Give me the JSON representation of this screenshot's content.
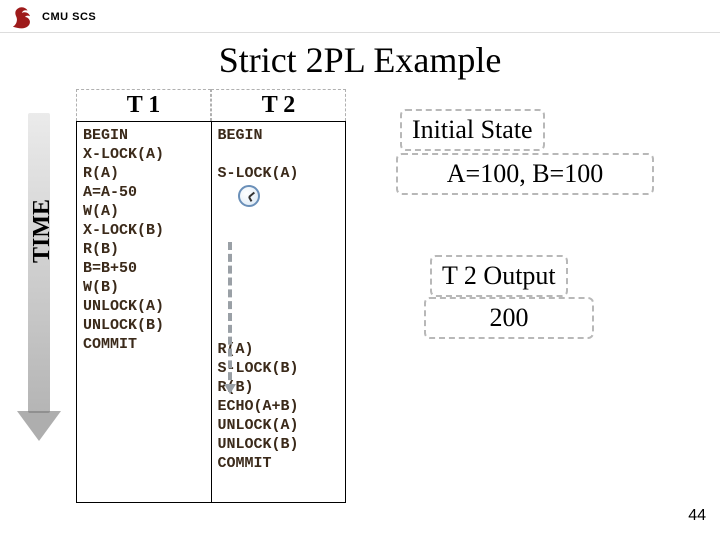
{
  "header": {
    "school": "CMU SCS"
  },
  "title": "Strict 2PL Example",
  "time_label": "TIME",
  "schedule": {
    "t1": {
      "header": "T 1",
      "ops": [
        "BEGIN",
        "X-LOCK(A)",
        "R(A)",
        "A=A-50",
        "W(A)",
        "X-LOCK(B)",
        "R(B)",
        "B=B+50",
        "W(B)",
        "UNLOCK(A)",
        "UNLOCK(B)",
        "COMMIT"
      ]
    },
    "t2": {
      "header": "T 2",
      "begin": "BEGIN",
      "first_lock": "S-LOCK(A)",
      "resume": [
        "R(A)",
        "S-LOCK(B)",
        "R(B)",
        "ECHO(A+B)",
        "UNLOCK(A)",
        "UNLOCK(B)",
        "COMMIT"
      ]
    }
  },
  "panels": {
    "initial_label": "Initial State",
    "initial_state": "A=100, B=100",
    "output_label": "T 2 Output",
    "output_value": "200"
  },
  "page_number": "44"
}
